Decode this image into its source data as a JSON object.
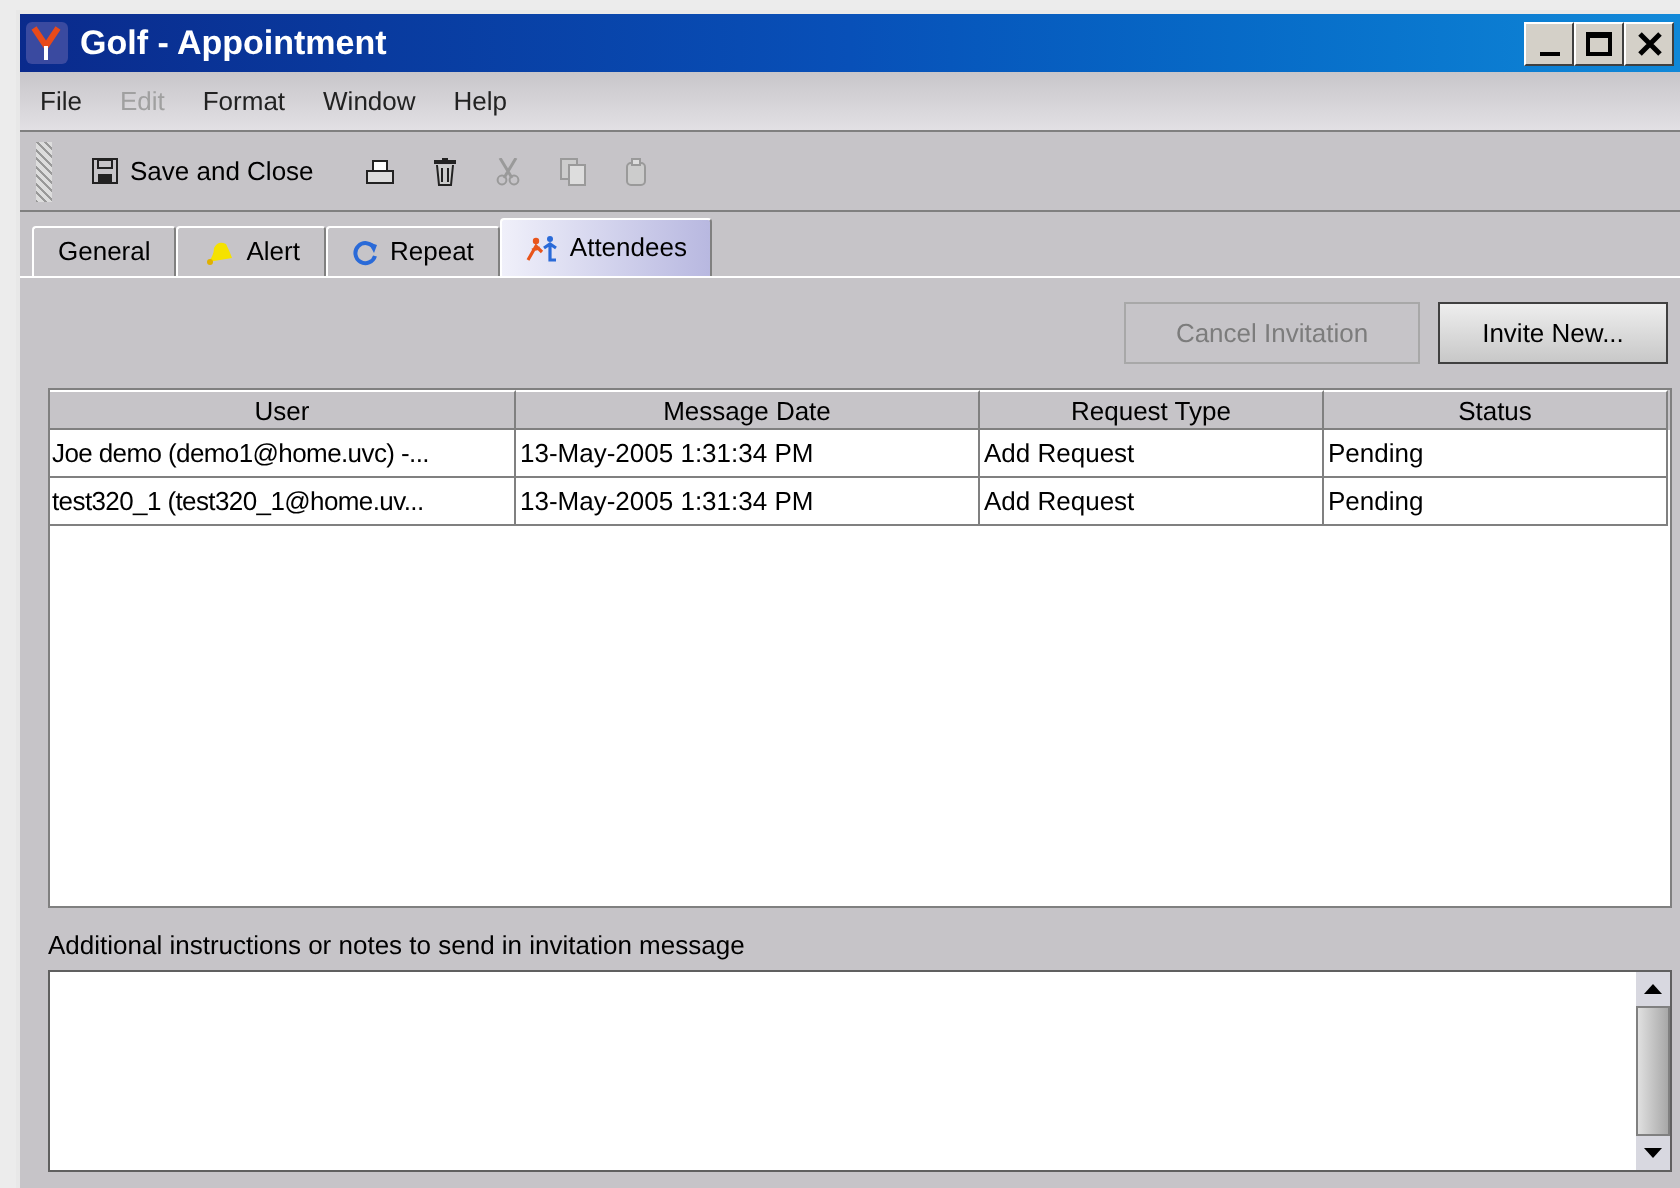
{
  "window": {
    "title": "Golf - Appointment"
  },
  "menu": [
    {
      "label": "File",
      "disabled": false
    },
    {
      "label": "Edit",
      "disabled": true
    },
    {
      "label": "Format",
      "disabled": false
    },
    {
      "label": "Window",
      "disabled": false
    },
    {
      "label": "Help",
      "disabled": false
    }
  ],
  "toolbar": [
    {
      "kind": "save",
      "label": "Save and Close",
      "disabled": false
    },
    {
      "kind": "print",
      "disabled": false
    },
    {
      "kind": "delete",
      "disabled": false
    },
    {
      "kind": "cut",
      "disabled": true
    },
    {
      "kind": "copy",
      "disabled": true
    },
    {
      "kind": "paste",
      "disabled": true
    }
  ],
  "tabs": [
    {
      "label": "General",
      "kind": "none",
      "selected": false
    },
    {
      "label": "Alert",
      "kind": "bell",
      "selected": false
    },
    {
      "label": "Repeat",
      "kind": "repeat",
      "selected": false
    },
    {
      "label": "Attendees",
      "kind": "people",
      "selected": true
    }
  ],
  "buttons": [
    {
      "label": "Cancel Invitation",
      "disabled": true
    },
    {
      "label": "Invite New...",
      "disabled": false
    }
  ],
  "table": {
    "columns": [
      "User",
      "Message Date",
      "Request Type",
      "Status"
    ],
    "rows": [
      [
        "Joe demo (demo1@home.uvc) -...",
        "13-May-2005 1:31:34 PM",
        "Add Request",
        "Pending"
      ],
      [
        "test320_1 (test320_1@home.uv...",
        "13-May-2005 1:31:34 PM",
        "Add Request",
        "Pending"
      ]
    ]
  },
  "notes": {
    "label": "Additional instructions or notes to send in invitation message"
  }
}
